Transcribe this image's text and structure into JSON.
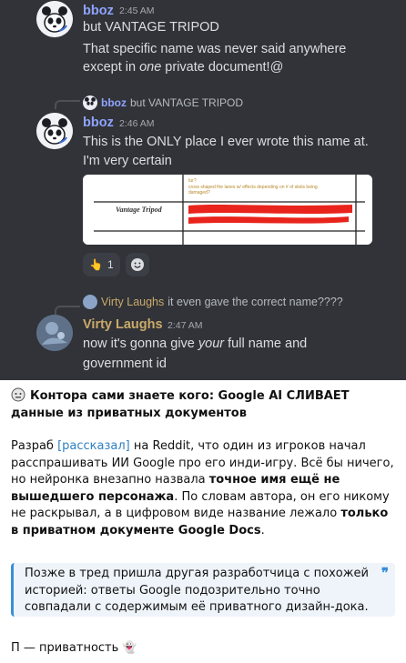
{
  "discord": {
    "messages": [
      {
        "author": "bboz",
        "time": "2:45 AM",
        "lines": [
          {
            "parts": [
              {
                "text": "but VANTAGE TRIPOD",
                "style": "normal"
              }
            ]
          },
          {
            "parts": [
              {
                "text": "That specific name was never said anywhere",
                "style": "normal"
              }
            ]
          },
          {
            "parts": [
              {
                "text": "except in ",
                "style": "normal"
              },
              {
                "text": "one",
                "style": "italic"
              },
              {
                "text": " private document!@",
                "style": "normal"
              }
            ]
          }
        ]
      },
      {
        "reply_to": {
          "author": "bboz",
          "text": "but VANTAGE TRIPOD"
        },
        "author": "bboz",
        "time": "2:46 AM",
        "lines": [
          {
            "parts": [
              {
                "text": "This is the ONLY place I ever wrote this name at.",
                "style": "normal"
              }
            ]
          },
          {
            "parts": [
              {
                "text": "I'm very certain",
                "style": "normal"
              }
            ]
          }
        ],
        "attachment": {
          "cell_label": "Vantage Tripod",
          "top_note_1": "tur?",
          "top_note_2": "cross shaped fire lanes w/ effects depending on # of skels being",
          "top_note_3": "damaged?"
        },
        "reactions": [
          {
            "icon": "pointing-hand-icon",
            "emoji": "👆",
            "count": "1"
          },
          {
            "icon": "add-reaction-icon",
            "emoji": "☺",
            "count": ""
          }
        ]
      },
      {
        "reply_to": {
          "author": "Virty Laughs",
          "text": "it even gave the correct name????"
        },
        "author": "Virty Laughs",
        "time": "2:47 AM",
        "lines": [
          {
            "parts": [
              {
                "text": "now it's gonna give ",
                "style": "normal"
              },
              {
                "text": "your",
                "style": "italic"
              },
              {
                "text": " full name and",
                "style": "normal"
              }
            ]
          },
          {
            "parts": [
              {
                "text": "government id",
                "style": "normal"
              }
            ]
          }
        ]
      }
    ]
  },
  "post": {
    "headline_emoji": "😐",
    "headline": "Контора сами знаете кого: Google AI СЛИВАЕТ данные из приватных документов",
    "p1_a": "Разраб ",
    "p1_link": "[рассказал]",
    "p1_b": " на Reddit, что один из игроков начал расспрашивать ИИ Google про его инди-игру. Всё бы ничего, но нейронка внезапно назвала ",
    "p1_bold1": "точное имя ещё не вышедшего персонажа",
    "p1_c": ". По словам автора, он его никому не раскрывал, а в цифровом виде название лежало ",
    "p1_bold2": "только в приватном документе Google Docs",
    "p1_d": ".",
    "quote": "Позже в тред пришла другая разработчица с похожей историей: ответы Google подозрительно точно совпадали с содержимым её приватного дизайн-дока.",
    "quote_mark": "❞",
    "footer_text": "П — приватность",
    "footer_emoji": "👻"
  },
  "colors": {
    "discord_bg": "#313338",
    "bboz_name": "#8fa3ff",
    "virty_name": "#cbaa6a",
    "link": "#2f7fc1",
    "quote_accent": "#3a8fd6",
    "redaction": "#e8241c"
  }
}
